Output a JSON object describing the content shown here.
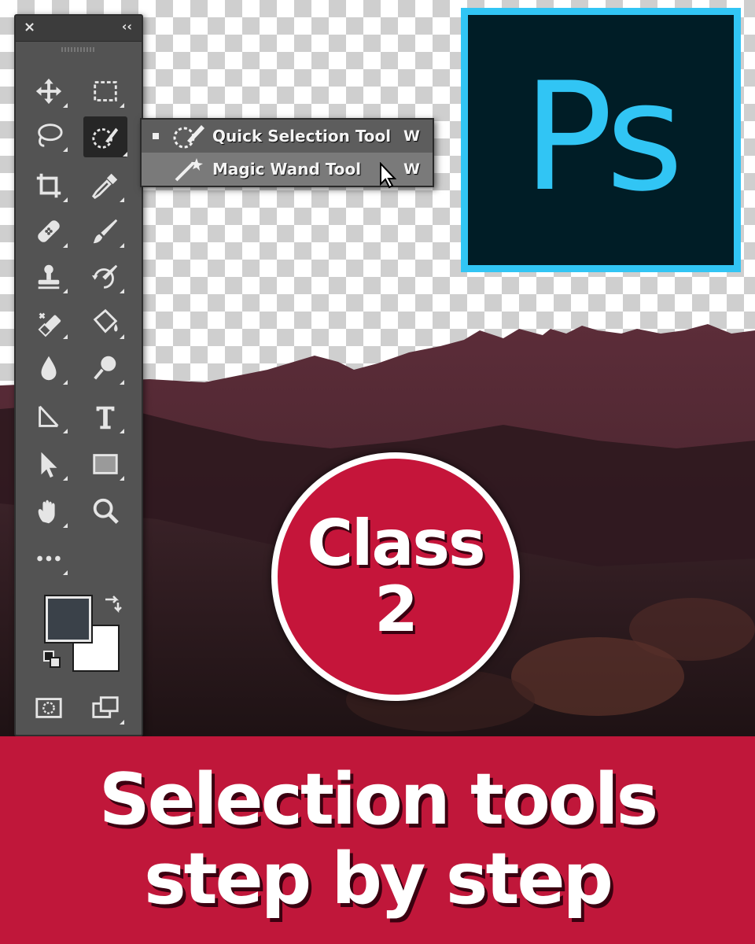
{
  "logo": {
    "text": "Ps",
    "background": "#001d26",
    "accent": "#31c5f4"
  },
  "toolbar": {
    "close_glyph": "×",
    "collapse_glyph": "‹‹",
    "tools": [
      "move-tool",
      "rectangular-marquee-tool",
      "lasso-tool",
      "quick-selection-tool",
      "crop-tool",
      "eyedropper-tool",
      "spot-healing-brush-tool",
      "brush-tool",
      "clone-stamp-tool",
      "history-brush-tool",
      "eraser-tool",
      "paint-bucket-tool",
      "blur-tool",
      "dodge-tool",
      "pen-tool",
      "type-tool",
      "path-selection-tool",
      "rectangle-tool",
      "hand-tool",
      "zoom-tool",
      "edit-toolbar",
      "",
      "foreground-background-colors",
      "quick-mask-mode",
      "screen-mode"
    ],
    "foreground_color": "#3a4149",
    "background_color": "#ffffff"
  },
  "flyout": {
    "items": [
      {
        "label": "Quick Selection Tool",
        "shortcut": "W",
        "icon": "quick-selection-icon",
        "selected": true
      },
      {
        "label": "Magic Wand Tool",
        "shortcut": "W",
        "icon": "magic-wand-icon",
        "hovered": true
      }
    ]
  },
  "badge": {
    "line1": "Class",
    "line2": "2",
    "color": "#c5153a"
  },
  "banner": {
    "line1": "Selection tools",
    "line2": "step by step",
    "color": "#c0173a"
  }
}
